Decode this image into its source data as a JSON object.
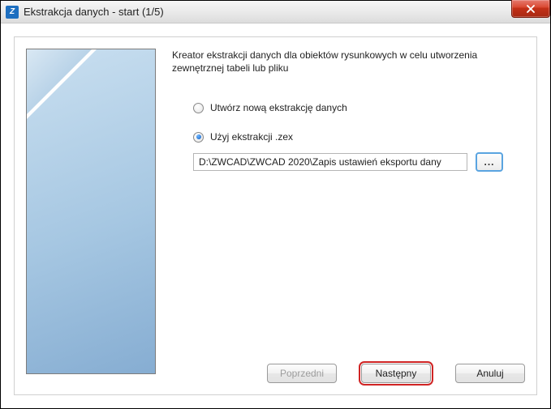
{
  "window": {
    "title": "Ekstrakcja danych - start (1/5)"
  },
  "intro": "Kreator ekstrakcji danych dla obiektów rysunkowych w celu utworzenia zewnętrznej tabeli lub pliku",
  "options": {
    "create_new": "Utwórz nową ekstrakcję danych",
    "use_existing": "Użyj ekstrakcji .zex",
    "selected": "use_existing"
  },
  "path": {
    "value": "D:\\ZWCAD\\ZWCAD 2020\\Zapis ustawień eksportu dany",
    "browse_label": "..."
  },
  "buttons": {
    "prev": "Poprzedni",
    "next": "Następny",
    "cancel": "Anuluj"
  },
  "icons": {
    "app": "Z",
    "close": "×"
  }
}
